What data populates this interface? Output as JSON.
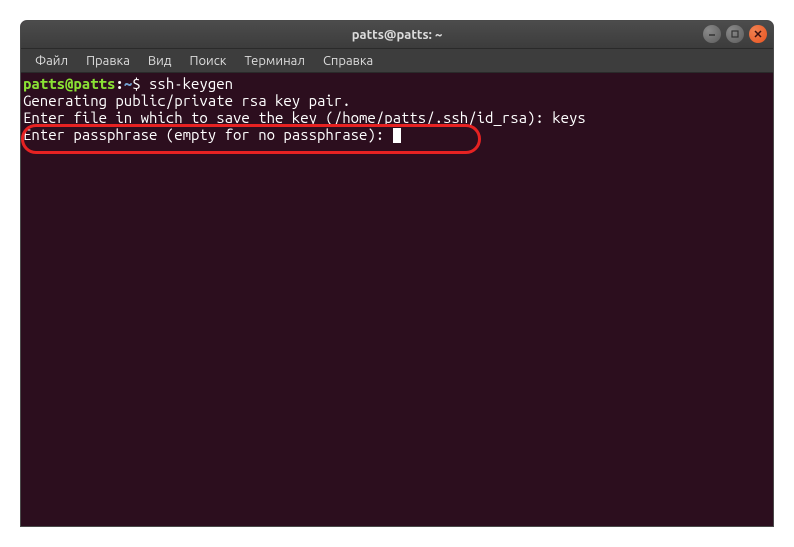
{
  "titlebar": {
    "title": "patts@patts: ~"
  },
  "menubar": {
    "items": [
      "Файл",
      "Правка",
      "Вид",
      "Поиск",
      "Терминал",
      "Справка"
    ]
  },
  "prompt": {
    "user_host": "patts@patts",
    "colon": ":",
    "path": "~",
    "dollar": "$ "
  },
  "terminal": {
    "command": "ssh-keygen",
    "line1": "Generating public/private rsa key pair.",
    "line2": "Enter file in which to save the key (/home/patts/.ssh/id_rsa): keys",
    "line3": "Enter passphrase (empty for no passphrase): "
  }
}
